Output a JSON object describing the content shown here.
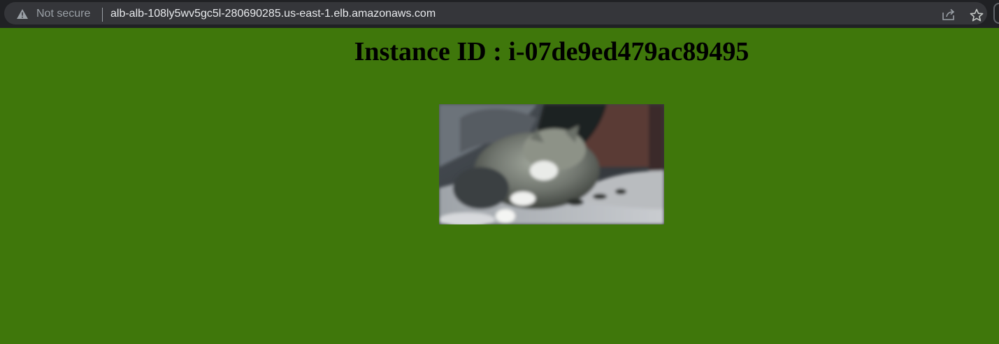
{
  "browser": {
    "security_label": "Not secure",
    "url": "alb-alb-108ly5wv5gc5l-280690285.us-east-1.elb.amazonaws.com",
    "icons": [
      "warning-icon",
      "share-icon",
      "star-icon"
    ]
  },
  "page": {
    "heading": "Instance ID : i-07de9ed479ac89495",
    "background_color": "#3f770b",
    "image_label": "cat-photo"
  }
}
